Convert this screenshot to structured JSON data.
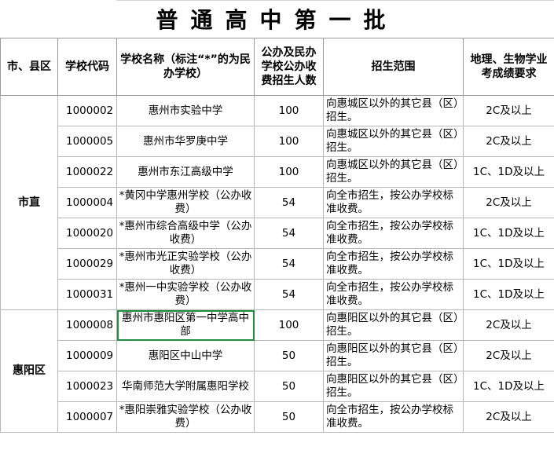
{
  "title": "普通高中第一批",
  "headers": {
    "district": "市、县区",
    "code": "学校代码",
    "school": "学校名称（标注“*”的为民办学校）",
    "quota": "公办及民办学校公办收费招生人数",
    "scope": "招生范围",
    "requirement": "地理、生物学业考成绩要求"
  },
  "groups": [
    {
      "district": "市直",
      "rows": [
        {
          "code": "1000002",
          "school": "惠州市实验中学",
          "quota": "100",
          "scope": "向惠城区以外的其它县（区）招生。",
          "req": "2C及以上"
        },
        {
          "code": "1000005",
          "school": "惠州市华罗庚中学",
          "quota": "100",
          "scope": "向惠城区以外的其它县（区）招生。",
          "req": "2C及以上"
        },
        {
          "code": "1000022",
          "school": "惠州市东江高级中学",
          "quota": "100",
          "scope": "向惠城区以外的其它县（区）招生。",
          "req": "1C、1D及以上"
        },
        {
          "code": "1000004",
          "school": "*黄冈中学惠州学校（公办收费）",
          "quota": "54",
          "scope": "向全市招生，按公办学校标准收费。",
          "req": "2C及以上"
        },
        {
          "code": "1000020",
          "school": "*惠州市综合高级中学（公办收费）",
          "quota": "54",
          "scope": "向全市招生，按公办学校标准收费。",
          "req": "1C、1D及以上"
        },
        {
          "code": "1000029",
          "school": "*惠州市光正实验学校（公办收费）",
          "quota": "54",
          "scope": "向全市招生，按公办学校标准收费。",
          "req": "1C、1D及以上"
        },
        {
          "code": "1000031",
          "school": "*惠州一中实验学校（公办收费）",
          "quota": "54",
          "scope": "向全市招生，按公办学校标准收费。",
          "req": "1C、1D及以上"
        }
      ]
    },
    {
      "district": "惠阳区",
      "rows": [
        {
          "code": "1000008",
          "school": "惠州市惠阳区第一中学高中部",
          "quota": "100",
          "scope": "向惠阳区以外的其它县（区）招生。",
          "req": "2C及以上"
        },
        {
          "code": "1000009",
          "school": "惠阳区中山中学",
          "quota": "50",
          "scope": "向惠阳区以外的其它县（区）招生。",
          "req": "2C及以上"
        },
        {
          "code": "1000023",
          "school": "华南师范大学附属惠阳学校",
          "quota": "50",
          "scope": "向惠阳区以外的其它县（区）招生。",
          "req": "1C、1D及以上"
        },
        {
          "code": "1000007",
          "school": "*惠阳崇雅实验学校（公办收费）",
          "quota": "50",
          "scope": "向全市招生，按公办学校标准收费。",
          "req": "2C及以上"
        }
      ]
    }
  ],
  "selected_cell": "groups.1.rows.0.school"
}
